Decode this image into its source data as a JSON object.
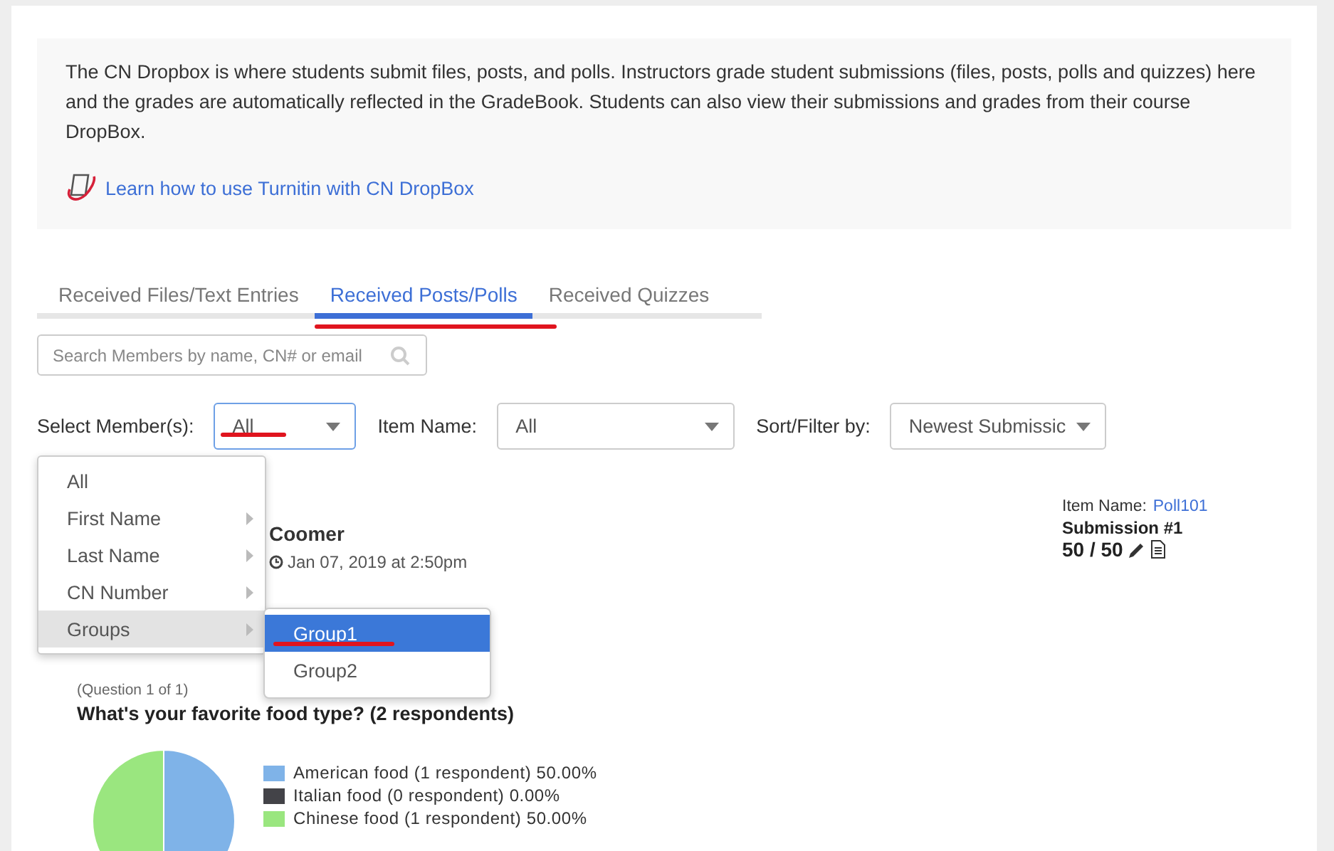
{
  "intro": {
    "text": "The CN Dropbox is where students submit files, posts, and polls. Instructors grade student submissions (files, posts, polls and quizzes) here and the grades are automatically reflected in the GradeBook. Students can also view their submissions and grades from their course DropBox.",
    "link": "Learn how to use Turnitin with CN DropBox"
  },
  "tabs": [
    {
      "label": "Received Files/Text Entries",
      "selected": false
    },
    {
      "label": "Received Posts/Polls",
      "selected": true
    },
    {
      "label": "Received Quizzes",
      "selected": false
    }
  ],
  "search": {
    "placeholder": "Search Members by name, CN# or email"
  },
  "filters": [
    {
      "label": "Select Member(s):",
      "value": "All",
      "focused": true
    },
    {
      "label": "Item Name:",
      "value": "All",
      "focused": false
    },
    {
      "label": "Sort/Filter by:",
      "value": "Newest Submissic",
      "focused": false
    }
  ],
  "member_menu": {
    "items": [
      {
        "label": "All",
        "has_submenu": false,
        "selected": false
      },
      {
        "label": "First Name",
        "has_submenu": true,
        "selected": false
      },
      {
        "label": "Last Name",
        "has_submenu": true,
        "selected": false
      },
      {
        "label": "CN Number",
        "has_submenu": true,
        "selected": false
      },
      {
        "label": "Groups",
        "has_submenu": true,
        "selected": true
      }
    ],
    "submenu": [
      {
        "label": "Group1",
        "selected": true
      },
      {
        "label": "Group2",
        "selected": false
      }
    ]
  },
  "submission": {
    "name": "Coomer",
    "date": "Jan 07, 2019 at 2:50pm",
    "item_label": "Item Name:",
    "item_value": "Poll101",
    "number": "Submission #1",
    "score": "50 / 50"
  },
  "question": {
    "counter": "(Question 1 of 1)",
    "title": "What's your favorite food type? (2 respondents)",
    "legend": [
      {
        "detail": "(1 respondent) 50.00%",
        "color": "#7fb3e8"
      },
      {
        "detail": "(0 respondent) 0.00%",
        "color": "#434348"
      },
      {
        "detail": "(1 respondent) 50.00%",
        "color": "#9ae67f"
      }
    ],
    "chart_data": {
      "type": "pie",
      "categories": [
        "American food",
        "Italian food",
        "Chinese food"
      ],
      "values": [
        50,
        0,
        50
      ]
    }
  }
}
